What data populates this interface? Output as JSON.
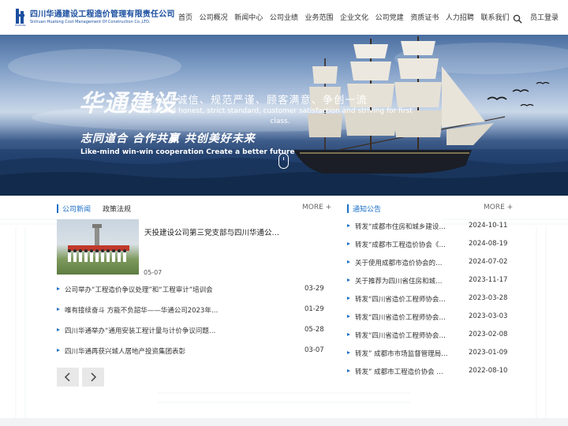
{
  "header": {
    "logo_cn": "四川华通建设工程造价管理有限责任公司",
    "logo_en": "Sichuan Huatong Cost Management Of Construction Co.,LTD.",
    "logo_mark_text": "HUATONG",
    "nav": [
      "首页",
      "公司概况",
      "新闻中心",
      "公司业绩",
      "业务范围",
      "企业文化",
      "公司党建",
      "资质证书",
      "人力招聘",
      "联系我们"
    ],
    "staff_login": "员工登录",
    "search_icon": "search-icon"
  },
  "banner": {
    "hero_cn": "华通建设",
    "slogan_cn": "公正诚信、规范严谨、顾客满意、争创一流",
    "slogan_en": "Fair and honest, strict standard, customer satisfaction and striving for first class.",
    "sub_cn": "志同道合 合作共赢 共创美好未来",
    "sub_en": "Like-mind win-win cooperation Create a better future",
    "scroll_icon": "mouse-scroll-icon"
  },
  "news": {
    "tab_active": "公司新闻",
    "tab_inactive": "政策法规",
    "more": "MORE +",
    "featured": {
      "title": "天投建设公司第三党支部与四川华通公…",
      "date": "05-07"
    },
    "items": [
      {
        "title": "公司举办“工程造价争议处理”和“工程审计”培训会",
        "date": "03-29"
      },
      {
        "title": "唯有接续奋斗 方能不负韶华——华通公司2023年…",
        "date": "01-29"
      },
      {
        "title": "四川华通举办“通用安装工程计量与计价争议问题…",
        "date": "05-28"
      },
      {
        "title": "四川华通再获兴城人居地产投资集团表彰",
        "date": "03-07"
      }
    ]
  },
  "notices": {
    "tab": "通知公告",
    "more": "MORE +",
    "items": [
      {
        "title": "转发“成都市住房和城乡建设…",
        "date": "2024-10-11"
      },
      {
        "title": "转发“成都市工程造价协会《…",
        "date": "2024-08-19"
      },
      {
        "title": "关于使用成都市造价协会的…",
        "date": "2024-07-02"
      },
      {
        "title": "关于推荐为四川省住房和城…",
        "date": "2023-11-17"
      },
      {
        "title": "转发“四川省造价工程师协会…",
        "date": "2023-03-28"
      },
      {
        "title": "转发“四川省造价工程师协会…",
        "date": "2023-03-03"
      },
      {
        "title": "转发“四川省造价工程师协会…",
        "date": "2023-02-08"
      },
      {
        "title": "转发” 成都市市场监督管理局…",
        "date": "2023-01-09"
      },
      {
        "title": "转发” 成都市工程造价协会 …",
        "date": "2022-08-10"
      }
    ]
  },
  "colors": {
    "brand": "#1b4fa0",
    "accent": "#1b6fc7"
  }
}
